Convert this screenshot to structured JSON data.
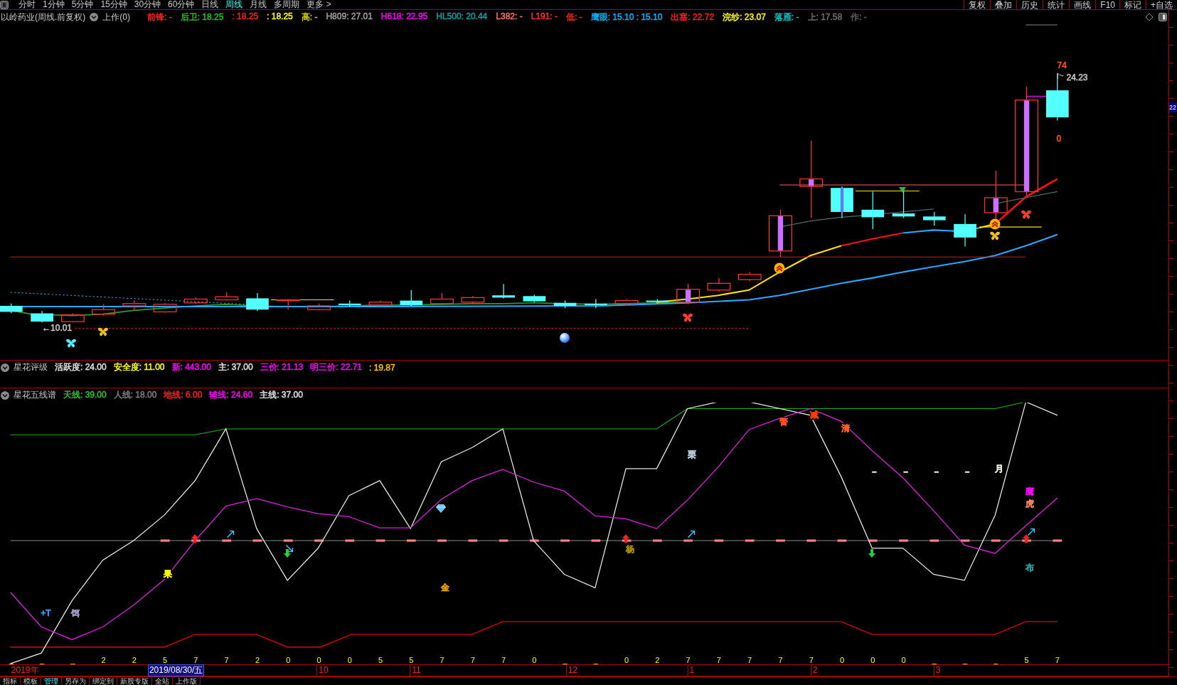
{
  "toolbar": {
    "tabs": [
      {
        "label": "分时",
        "selected": false
      },
      {
        "label": "1分钟",
        "selected": false
      },
      {
        "label": "5分钟",
        "selected": false
      },
      {
        "label": "15分钟",
        "selected": false
      },
      {
        "label": "30分钟",
        "selected": false
      },
      {
        "label": "60分钟",
        "selected": false
      },
      {
        "label": "日线",
        "selected": false
      },
      {
        "label": "周线",
        "selected": true
      },
      {
        "label": "月线",
        "selected": false
      },
      {
        "label": "多周期",
        "selected": false
      },
      {
        "label": "更多 >",
        "selected": false
      }
    ],
    "buttons": [
      "复权",
      "叠加",
      "历史",
      "统计",
      "画线",
      "F10",
      "标记",
      "+自选"
    ]
  },
  "header": {
    "security": "以岭药业(周线.前复权)",
    "status": "上作(0)",
    "readouts": [
      {
        "text": "前锋: -",
        "color": "#ff2020"
      },
      {
        "text": "后卫: 18.25",
        "color": "#20c020"
      },
      {
        "text": ": 18.25",
        "color": "#ff2020"
      },
      {
        "text": ": 18.25",
        "color": "#ffff00"
      },
      {
        "text": "高: -",
        "color": "#d0d000"
      },
      {
        "text": "H809: 27.01",
        "color": "#a0a0a0"
      },
      {
        "text": "H618: 22.95",
        "color": "#ff00ff"
      },
      {
        "text": "HL500: 20.44",
        "color": "#00a0a0"
      },
      {
        "text": "L382: -",
        "color": "#ff7070"
      },
      {
        "text": "L191: -",
        "color": "#ff3030"
      },
      {
        "text": "低: -",
        "color": "#ff2020"
      },
      {
        "text": "鹰眼: 15.10 : 15.10",
        "color": "#00b0ff"
      },
      {
        "text": "出塞: 22.72",
        "color": "#ff2020"
      },
      {
        "text": "浣纱: 23.07",
        "color": "#ffff00"
      },
      {
        "text": "落雁: -",
        "color": "#00c0c0"
      },
      {
        "text": "上: 17.58",
        "color": "#707070"
      },
      {
        "text": "作: -",
        "color": "#606060"
      }
    ]
  },
  "main_chart": {
    "annotations": [
      {
        "text": "←10.01",
        "color": "#c8c8c8"
      },
      {
        "text": "74",
        "color": "#ff5a1e"
      },
      {
        "text": "24.23",
        "color": "#c8c8c8"
      },
      {
        "text": "0",
        "color": "#ff5a1e"
      }
    ],
    "axis_label": "22"
  },
  "panels": [
    {
      "title": "星花评级",
      "readouts": [
        {
          "text": "活跃度: 24.00",
          "color": "#e0e0e0"
        },
        {
          "text": "安全度: 11.00",
          "color": "#ffff00"
        },
        {
          "text": "新: 443.00",
          "color": "#ff00ff"
        },
        {
          "text": "主: 37.00",
          "color": "#e0e0e0"
        },
        {
          "text": "三价: 21.13",
          "color": "#ff00ff"
        },
        {
          "text": "明三价: 22.71",
          "color": "#ff00ff"
        },
        {
          "text": ": 19.87",
          "color": "#ffc000"
        }
      ]
    },
    {
      "title": "星花五线谱",
      "readouts": [
        {
          "text": "天线: 39.00",
          "color": "#30c030"
        },
        {
          "text": "人线: 18.00",
          "color": "#808080"
        },
        {
          "text": "地线: 6.00",
          "color": "#ff2020"
        },
        {
          "text": "辅线: 24.60",
          "color": "#ff00ff"
        },
        {
          "text": "主线: 37.00",
          "color": "#e0e0e0"
        }
      ]
    }
  ],
  "lower_chart": {
    "labels": [
      {
        "text": "+T",
        "color": "#3c9cff"
      },
      {
        "text": "饵",
        "color": "#a0a0c8"
      },
      {
        "text": "果",
        "color": "#ffff00"
      },
      {
        "text": "金",
        "color": "#e8a000"
      },
      {
        "text": "杨",
        "color": "#a08c00"
      },
      {
        "text": "栗",
        "color": "#c0d0e0"
      },
      {
        "text": "警",
        "color": "#ff5020"
      },
      {
        "text": "减",
        "color": "#ff4000"
      },
      {
        "text": "清",
        "color": "#ff6020"
      },
      {
        "text": "–",
        "color": "#f0f0e0"
      },
      {
        "text": "–",
        "color": "#f0f0e0"
      },
      {
        "text": "–",
        "color": "#f0f0e0"
      },
      {
        "text": "–",
        "color": "#f0f0e0"
      },
      {
        "text": "月",
        "color": "#f0f0e0"
      },
      {
        "text": "鹰",
        "color": "#ff00ff"
      },
      {
        "text": "虎",
        "color": "#ff8060"
      },
      {
        "text": "布",
        "color": "#20a0a0"
      }
    ],
    "signal_row": [
      "_",
      "_",
      "_",
      "2",
      "2",
      "5",
      "7",
      "7",
      "2",
      "0",
      "0",
      "0",
      "5",
      "5",
      "7",
      "7",
      "7",
      "0",
      "_",
      "_",
      "0",
      "2",
      "7",
      "7",
      "7",
      "7",
      "7",
      "0",
      "0",
      "0",
      "_",
      "_",
      "_",
      "5",
      "7"
    ]
  },
  "date_axis": [
    {
      "label": "2019年",
      "kind": "year"
    },
    {
      "label": "2019/08/30/五",
      "kind": "cursor"
    },
    {
      "label": "10",
      "kind": "month"
    },
    {
      "label": "11",
      "kind": "month"
    },
    {
      "label": "12",
      "kind": "month"
    },
    {
      "label": "1",
      "kind": "month"
    },
    {
      "label": "2",
      "kind": "month"
    },
    {
      "label": "3",
      "kind": "month"
    }
  ],
  "bottom_tabs": [
    {
      "label": "指标",
      "selected": false
    },
    {
      "label": "模板",
      "selected": false
    },
    {
      "label": "管理",
      "selected": true
    },
    {
      "label": "另存为",
      "selected": false
    },
    {
      "label": "绑定到",
      "selected": false
    },
    {
      "label": "新股专版",
      "selected": false
    },
    {
      "label": "全站",
      "selected": false
    },
    {
      "label": "上作版",
      "selected": false
    }
  ]
}
